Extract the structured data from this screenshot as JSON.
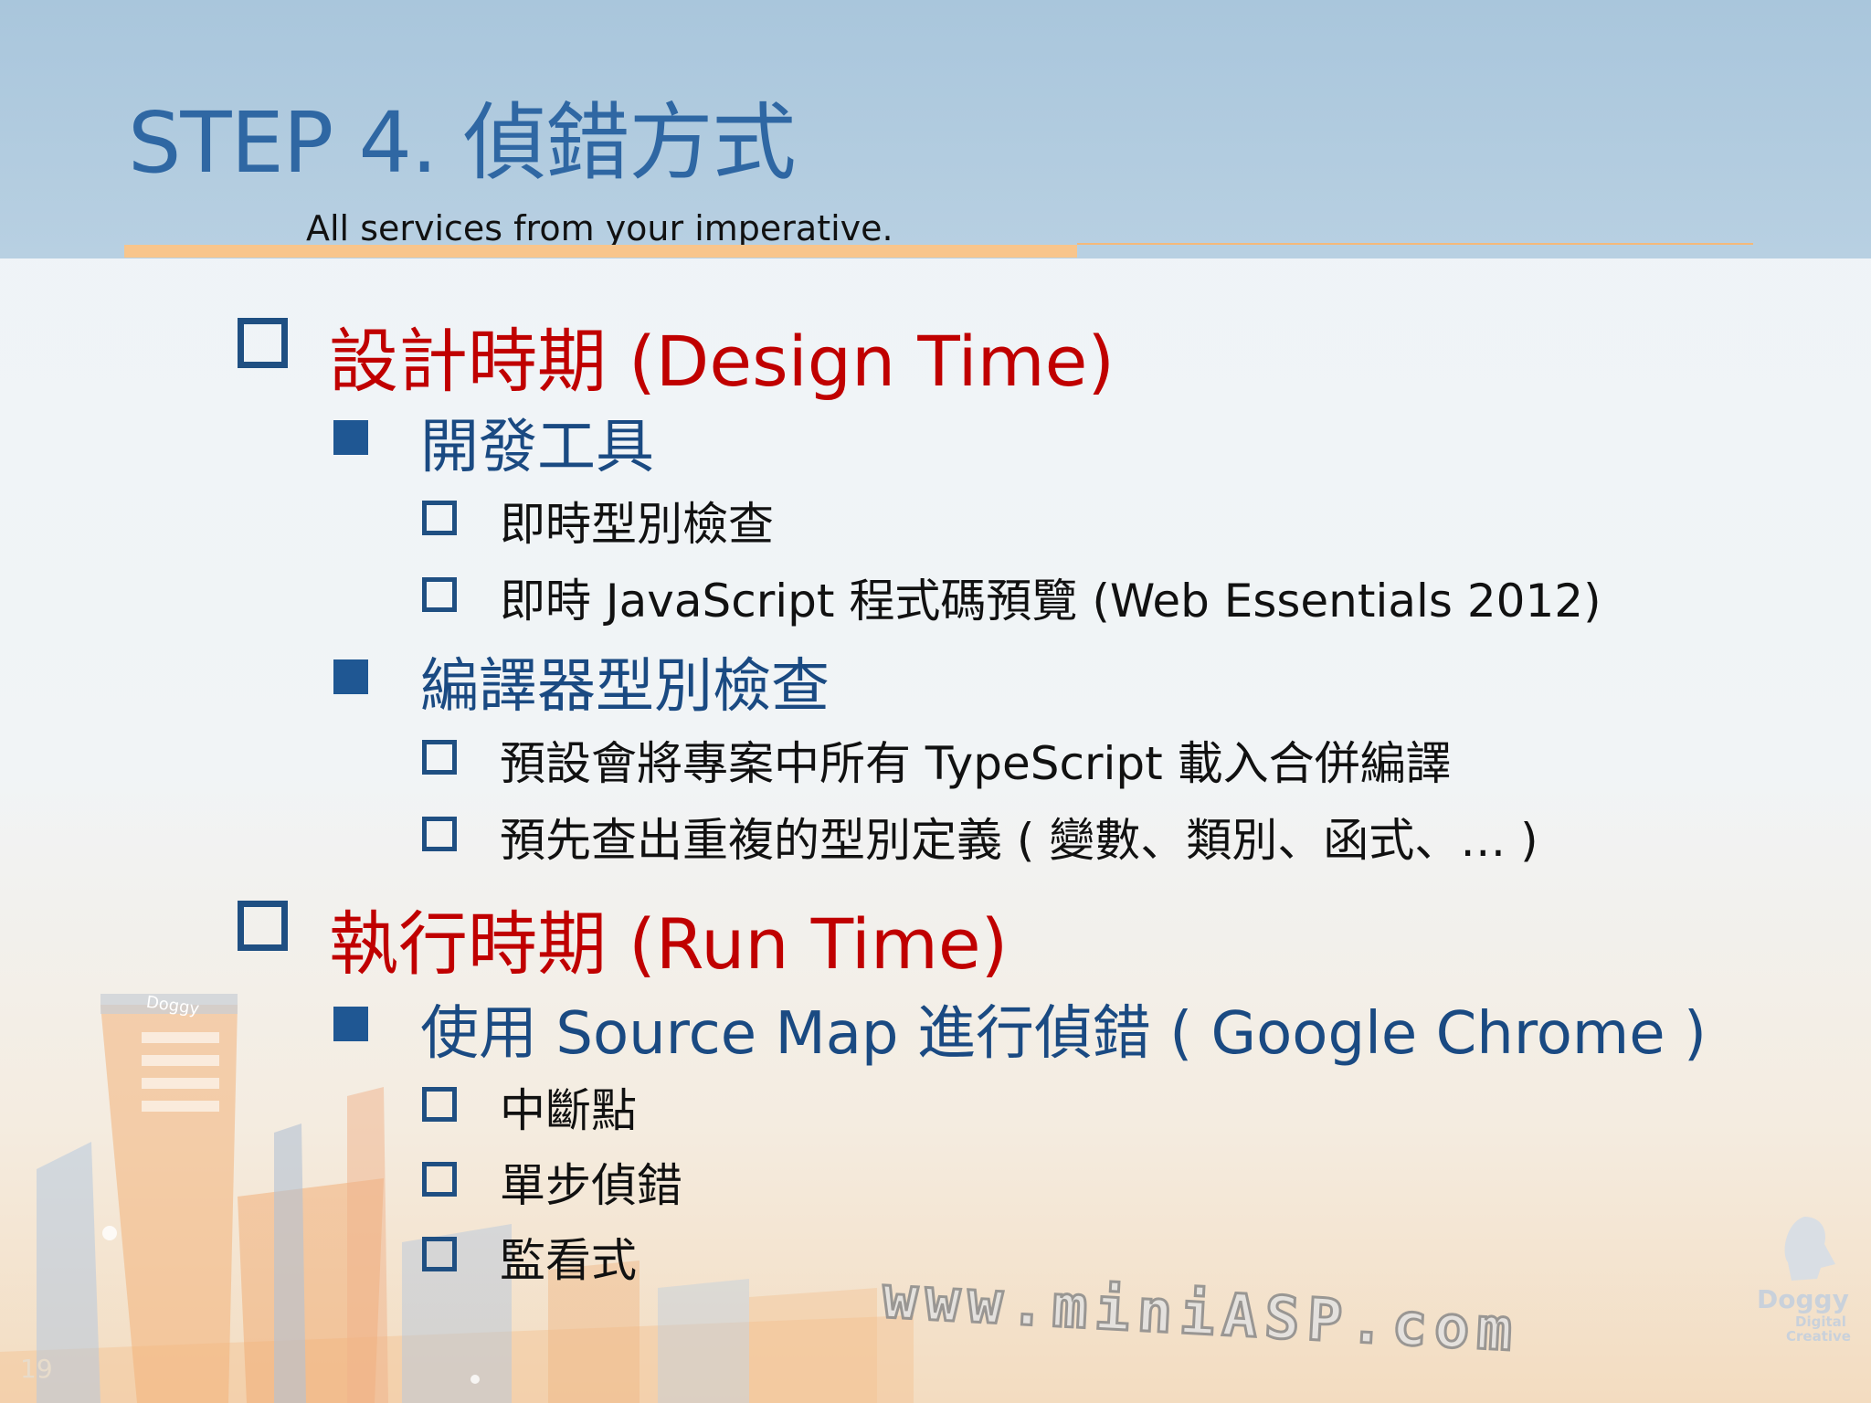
{
  "slide": {
    "title": "STEP 4. 偵錯方式",
    "subtitle": "All services from your imperative.",
    "page_number": "19",
    "watermark": "www.miniASP.com",
    "logo_text": [
      "Doggy",
      "Digital",
      "Creative"
    ],
    "building_sign": "Doggy"
  },
  "items": [
    {
      "level": 1,
      "text": "設計時期 (Design Time)"
    },
    {
      "level": 2,
      "text": "開發工具"
    },
    {
      "level": 3,
      "text": "即時型別檢查"
    },
    {
      "level": 3,
      "text": "即時 JavaScript 程式碼預覽 (Web Essentials 2012)"
    },
    {
      "level": 2,
      "text": "編譯器型別檢查"
    },
    {
      "level": 3,
      "text": "預設會將專案中所有 TypeScript 載入合併編譯"
    },
    {
      "level": 3,
      "text": "預先查出重複的型別定義 ( 變數、類別、函式、… )"
    },
    {
      "level": 1,
      "text": "執行時期 (Run Time)"
    },
    {
      "level": 2,
      "text": "使用 Source Map 進行偵錯 ( Google Chrome )"
    },
    {
      "level": 3,
      "text": "中斷點"
    },
    {
      "level": 3,
      "text": "單步偵錯"
    },
    {
      "level": 3,
      "text": "監看式"
    }
  ],
  "colors": {
    "title": "#2f67a3",
    "level1": "#c00000",
    "level2": "#1a4a82",
    "level3": "#111111",
    "accent_rule": "#f8c58c"
  }
}
